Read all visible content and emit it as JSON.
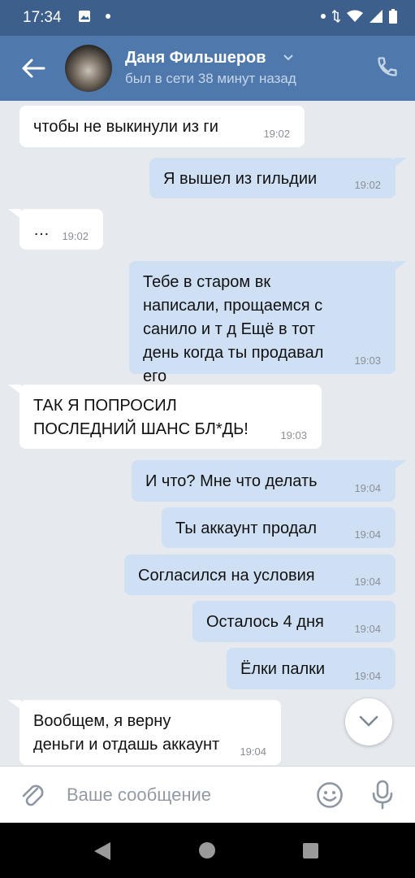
{
  "status_bar": {
    "time": "17:34"
  },
  "header": {
    "contact_name": "Даня Фильшеров",
    "presence": "был в сети 38 минут назад"
  },
  "messages": [
    {
      "dir": "in",
      "text": "чтобы не выкинули из ги",
      "time": "19:02"
    },
    {
      "dir": "out",
      "text": "Я вышел из гильдии",
      "time": "19:02"
    },
    {
      "dir": "in",
      "text": "…",
      "time": "19:02"
    },
    {
      "dir": "out",
      "text": "Тебе в старом вк написали, прощаемся с санило и т д Ещё в тот день когда ты продавал его",
      "time": "19:03"
    },
    {
      "dir": "in",
      "text": "ТАК Я ПОПРОСИЛ ПОСЛЕДНИЙ ШАНС БЛ*ДЬ!",
      "time": "19:03"
    },
    {
      "dir": "out",
      "text": "И что? Мне что делать",
      "time": "19:04"
    },
    {
      "dir": "out",
      "text": "Ты аккаунт продал",
      "time": "19:04"
    },
    {
      "dir": "out",
      "text": "Согласился на условия",
      "time": "19:04"
    },
    {
      "dir": "out",
      "text": "Осталось 4 дня",
      "time": "19:04"
    },
    {
      "dir": "out",
      "text": "Ёлки палки",
      "time": "19:04"
    },
    {
      "dir": "in",
      "text": "Вообщем, я верну деньги и отдашь аккаунт",
      "time": "19:04"
    }
  ],
  "composer": {
    "placeholder": "Ваше сообщение"
  },
  "icons": {
    "back": "arrow-left-icon",
    "phone": "phone-icon",
    "scroll_down": "chevron-down-icon",
    "attach": "paperclip-icon",
    "emoji": "smiley-icon",
    "mic": "microphone-icon"
  },
  "colors": {
    "status_bar": "#3d5f8c",
    "header": "#4f79ad",
    "chat_background": "#e6e9ee",
    "incoming_bubble": "#ffffff",
    "outgoing_bubble": "#cfe0f5"
  }
}
